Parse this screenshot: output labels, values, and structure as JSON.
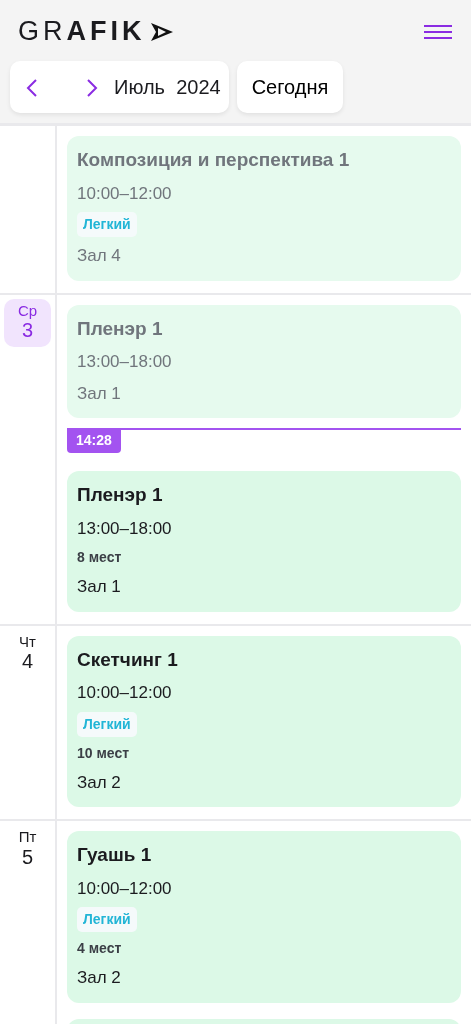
{
  "logo": {
    "text": "GR**AFIK**"
  },
  "toolbar": {
    "month": "Июль  2024",
    "today_button": "Сегодня"
  },
  "days": [
    {
      "items": [
        {
          "kind": "event",
          "past": true,
          "title": "Композиция и перспектива 1",
          "time": "10:00–12:00",
          "level": "Легкий",
          "room": "Зал 4"
        }
      ]
    },
    {
      "weekday": "Ср",
      "day": "3",
      "selected": true,
      "items": [
        {
          "kind": "event",
          "past": true,
          "title": "Пленэр 1",
          "time": "13:00–18:00",
          "room": "Зал 1"
        },
        {
          "kind": "now",
          "time": "14:28"
        },
        {
          "kind": "event",
          "past": false,
          "title": "Пленэр 1",
          "time": "13:00–18:00",
          "seats": "8 мест",
          "room": "Зал 1"
        }
      ]
    },
    {
      "weekday": "Чт",
      "day": "4",
      "selected": false,
      "items": [
        {
          "kind": "event",
          "past": false,
          "title": "Скетчинг 1",
          "time": "10:00–12:00",
          "level": "Легкий",
          "seats": "10 мест",
          "room": "Зал 2"
        }
      ]
    },
    {
      "weekday": "Пт",
      "day": "5",
      "selected": false,
      "items": [
        {
          "kind": "event",
          "past": false,
          "title": "Гуашь 1",
          "time": "10:00–12:00",
          "level": "Легкий",
          "seats": "4 мест",
          "room": "Зал 2"
        },
        {
          "kind": "cut"
        }
      ]
    }
  ]
}
